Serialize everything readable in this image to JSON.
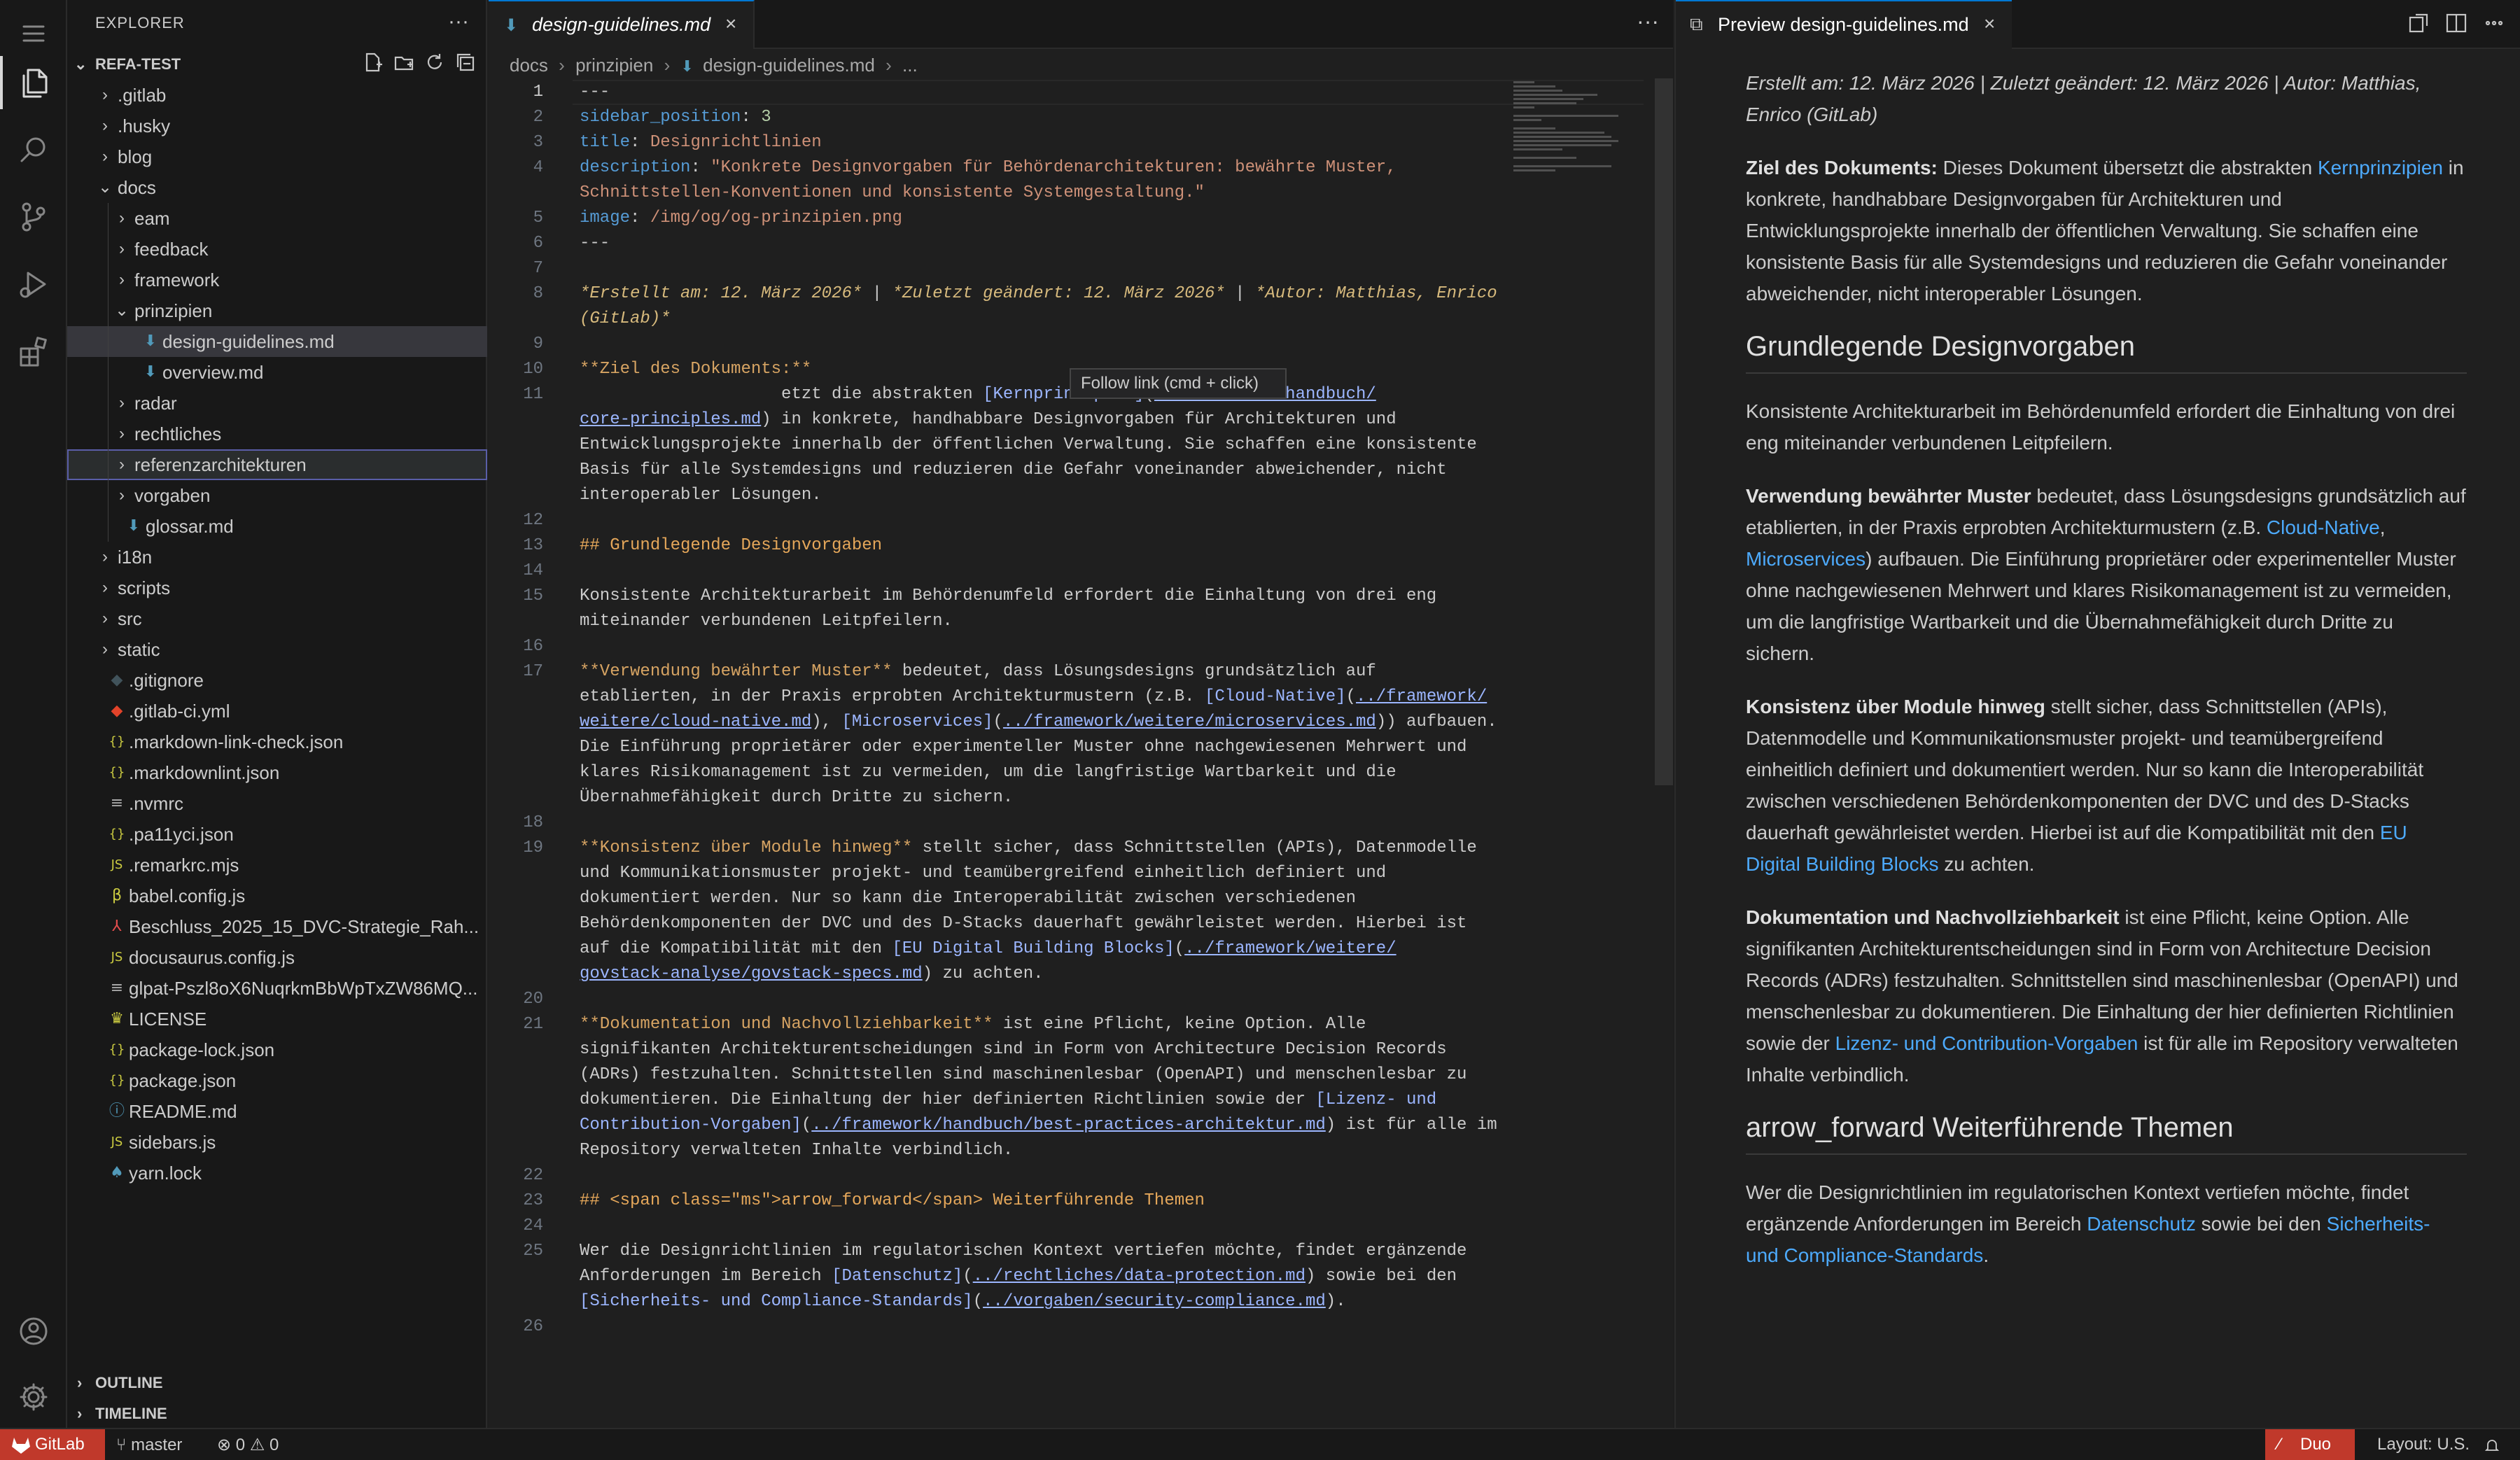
{
  "activity_bar": {
    "items": [
      {
        "name": "explorer",
        "active": true
      },
      {
        "name": "search",
        "active": false
      },
      {
        "name": "source-control",
        "active": false
      },
      {
        "name": "run-debug",
        "active": false
      },
      {
        "name": "extensions",
        "active": false
      }
    ]
  },
  "sidebar": {
    "title": "EXPLORER",
    "more": "···",
    "project": "REFA-TEST",
    "tree": [
      {
        "label": ".gitlab",
        "type": "folder",
        "depth": 0,
        "expanded": false
      },
      {
        "label": ".husky",
        "type": "folder",
        "depth": 0,
        "expanded": false
      },
      {
        "label": "blog",
        "type": "folder",
        "depth": 0,
        "expanded": false
      },
      {
        "label": "docs",
        "type": "folder",
        "depth": 0,
        "expanded": true
      },
      {
        "label": "eam",
        "type": "folder",
        "depth": 1,
        "expanded": false
      },
      {
        "label": "feedback",
        "type": "folder",
        "depth": 1,
        "expanded": false
      },
      {
        "label": "framework",
        "type": "folder",
        "depth": 1,
        "expanded": false
      },
      {
        "label": "prinzipien",
        "type": "folder",
        "depth": 1,
        "expanded": true
      },
      {
        "label": "design-guidelines.md",
        "type": "md",
        "depth": 2,
        "selected": true
      },
      {
        "label": "overview.md",
        "type": "md",
        "depth": 2
      },
      {
        "label": "radar",
        "type": "folder",
        "depth": 1,
        "expanded": false
      },
      {
        "label": "rechtliches",
        "type": "folder",
        "depth": 1,
        "expanded": false
      },
      {
        "label": "referenzarchitekturen",
        "type": "folder",
        "depth": 1,
        "expanded": false,
        "focused": true
      },
      {
        "label": "vorgaben",
        "type": "folder",
        "depth": 1,
        "expanded": false
      },
      {
        "label": "glossar.md",
        "type": "md",
        "depth": 1
      },
      {
        "label": "i18n",
        "type": "folder",
        "depth": 0,
        "expanded": false
      },
      {
        "label": "scripts",
        "type": "folder",
        "depth": 0,
        "expanded": false
      },
      {
        "label": "src",
        "type": "folder",
        "depth": 0,
        "expanded": false
      },
      {
        "label": "static",
        "type": "folder",
        "depth": 0,
        "expanded": false
      },
      {
        "label": ".gitignore",
        "type": "gitignore",
        "depth": 0
      },
      {
        "label": ".gitlab-ci.yml",
        "type": "gitlab",
        "depth": 0
      },
      {
        "label": ".markdown-link-check.json",
        "type": "json",
        "depth": 0
      },
      {
        "label": ".markdownlint.json",
        "type": "json",
        "depth": 0
      },
      {
        "label": ".nvmrc",
        "type": "text",
        "depth": 0
      },
      {
        "label": ".pa11yci.json",
        "type": "json",
        "depth": 0
      },
      {
        "label": ".remarkrc.mjs",
        "type": "js",
        "depth": 0
      },
      {
        "label": "babel.config.js",
        "type": "babel",
        "depth": 0
      },
      {
        "label": "Beschluss_2025_15_DVC-Strategie_Rah...",
        "type": "pdf",
        "depth": 0
      },
      {
        "label": "docusaurus.config.js",
        "type": "js",
        "depth": 0
      },
      {
        "label": "glpat-Pszl8oX6NuqrkmBbWpTxZW86MQ...",
        "type": "text",
        "depth": 0
      },
      {
        "label": "LICENSE",
        "type": "license",
        "depth": 0
      },
      {
        "label": "package-lock.json",
        "type": "json",
        "depth": 0
      },
      {
        "label": "package.json",
        "type": "json",
        "depth": 0
      },
      {
        "label": "README.md",
        "type": "info",
        "depth": 0
      },
      {
        "label": "sidebars.js",
        "type": "js",
        "depth": 0
      },
      {
        "label": "yarn.lock",
        "type": "yarn",
        "depth": 0
      }
    ],
    "outline": "OUTLINE",
    "timeline": "TIMELINE"
  },
  "editor": {
    "tab_label": "design-guidelines.md",
    "more": "···",
    "breadcrumbs": [
      "docs",
      "prinzipien",
      "design-guidelines.md",
      "..."
    ],
    "tooltip": "Follow link (cmd + click)",
    "lines": [
      {
        "n": "1",
        "segs": [
          [
            "p",
            "---"
          ]
        ]
      },
      {
        "n": "2",
        "segs": [
          [
            "k",
            "sidebar_position"
          ],
          [
            "p",
            ": "
          ],
          [
            "y",
            "3"
          ]
        ]
      },
      {
        "n": "3",
        "segs": [
          [
            "k",
            "title"
          ],
          [
            "p",
            ": "
          ],
          [
            "s",
            "Designrichtlinien"
          ]
        ]
      },
      {
        "n": "4",
        "segs": [
          [
            "k",
            "description"
          ],
          [
            "p",
            ": "
          ],
          [
            "s",
            "\"Konkrete Designvorgaben für Behördenarchitekturen: bewährte Muster,"
          ]
        ]
      },
      {
        "n": "",
        "segs": [
          [
            "s",
            "Schnittstellen-Konventionen und konsistente Systemgestaltung.\""
          ]
        ]
      },
      {
        "n": "5",
        "segs": [
          [
            "k",
            "image"
          ],
          [
            "p",
            ": "
          ],
          [
            "s",
            "/img/og/og-prinzipien.png"
          ]
        ]
      },
      {
        "n": "6",
        "segs": [
          [
            "p",
            "---"
          ]
        ]
      },
      {
        "n": "7",
        "segs": []
      },
      {
        "n": "8",
        "segs": [
          [
            "it",
            "*Erstellt am: 12. März 2026*"
          ],
          [
            "p",
            " | "
          ],
          [
            "it",
            "*Zuletzt geändert: 12. März 2026*"
          ],
          [
            "p",
            " | "
          ],
          [
            "it",
            "*Autor: Matthias, Enrico"
          ]
        ]
      },
      {
        "n": "",
        "segs": [
          [
            "it",
            "(GitLab)*"
          ]
        ]
      },
      {
        "n": "9",
        "segs": []
      },
      {
        "n": "10",
        "segs": [
          [
            "b",
            "**Ziel des Dokuments:**"
          ]
        ]
      },
      {
        "n": "11",
        "segs": [
          [
            "p",
            "                    etzt die abstrakten "
          ],
          [
            "lt",
            "[Kernprinzipien]"
          ],
          [
            "p",
            "("
          ],
          [
            "lk",
            "../framework/handbuch/"
          ]
        ]
      },
      {
        "n": "",
        "segs": [
          [
            "lk",
            "core-principles.md"
          ],
          [
            "p",
            ") in konkrete, handhabbare Designvorgaben für Architekturen und"
          ]
        ]
      },
      {
        "n": "",
        "segs": [
          [
            "p",
            "Entwicklungsprojekte innerhalb der öffentlichen Verwaltung. Sie schaffen eine konsistente"
          ]
        ]
      },
      {
        "n": "",
        "segs": [
          [
            "p",
            "Basis für alle Systemdesigns und reduzieren die Gefahr voneinander abweichender, nicht"
          ]
        ]
      },
      {
        "n": "",
        "segs": [
          [
            "p",
            "interoperabler Lösungen."
          ]
        ]
      },
      {
        "n": "12",
        "segs": []
      },
      {
        "n": "13",
        "segs": [
          [
            "hd",
            "## Grundlegende Designvorgaben"
          ]
        ]
      },
      {
        "n": "14",
        "segs": []
      },
      {
        "n": "15",
        "segs": [
          [
            "p",
            "Konsistente Architekturarbeit im Behördenumfeld erfordert die Einhaltung von drei eng"
          ]
        ]
      },
      {
        "n": "",
        "segs": [
          [
            "p",
            "miteinander verbundenen Leitpfeilern."
          ]
        ]
      },
      {
        "n": "16",
        "segs": []
      },
      {
        "n": "17",
        "segs": [
          [
            "b",
            "**Verwendung bewährter Muster**"
          ],
          [
            "p",
            " bedeutet, dass Lösungsdesigns grundsätzlich auf"
          ]
        ]
      },
      {
        "n": "",
        "segs": [
          [
            "p",
            "etablierten, in der Praxis erprobten Architekturmustern (z.B. "
          ],
          [
            "lt",
            "[Cloud-Native]"
          ],
          [
            "p",
            "("
          ],
          [
            "lk",
            "../framework/"
          ]
        ]
      },
      {
        "n": "",
        "segs": [
          [
            "lk",
            "weitere/cloud-native.md"
          ],
          [
            "p",
            "), "
          ],
          [
            "lt",
            "[Microservices]"
          ],
          [
            "p",
            "("
          ],
          [
            "lk",
            "../framework/weitere/microservices.md"
          ],
          [
            "p",
            ")) aufbauen."
          ]
        ]
      },
      {
        "n": "",
        "segs": [
          [
            "p",
            "Die Einführung proprietärer oder experimenteller Muster ohne nachgewiesenen Mehrwert und"
          ]
        ]
      },
      {
        "n": "",
        "segs": [
          [
            "p",
            "klares Risikomanagement ist zu vermeiden, um die langfristige Wartbarkeit und die"
          ]
        ]
      },
      {
        "n": "",
        "segs": [
          [
            "p",
            "Übernahmefähigkeit durch Dritte zu sichern."
          ]
        ]
      },
      {
        "n": "18",
        "segs": []
      },
      {
        "n": "19",
        "segs": [
          [
            "b",
            "**Konsistenz über Module hinweg**"
          ],
          [
            "p",
            " stellt sicher, dass Schnittstellen (APIs), Datenmodelle"
          ]
        ]
      },
      {
        "n": "",
        "segs": [
          [
            "p",
            "und Kommunikationsmuster projekt- und teamübergreifend einheitlich definiert und"
          ]
        ]
      },
      {
        "n": "",
        "segs": [
          [
            "p",
            "dokumentiert werden. Nur so kann die Interoperabilität zwischen verschiedenen"
          ]
        ]
      },
      {
        "n": "",
        "segs": [
          [
            "p",
            "Behördenkomponenten der DVC und des D-Stacks dauerhaft gewährleistet werden. Hierbei ist"
          ]
        ]
      },
      {
        "n": "",
        "segs": [
          [
            "p",
            "auf die Kompatibilität mit den "
          ],
          [
            "lt",
            "[EU Digital Building Blocks]"
          ],
          [
            "p",
            "("
          ],
          [
            "lk",
            "../framework/weitere/"
          ]
        ]
      },
      {
        "n": "",
        "segs": [
          [
            "lk",
            "govstack-analyse/govstack-specs.md"
          ],
          [
            "p",
            ") zu achten."
          ]
        ]
      },
      {
        "n": "20",
        "segs": []
      },
      {
        "n": "21",
        "segs": [
          [
            "b",
            "**Dokumentation und Nachvollziehbarkeit**"
          ],
          [
            "p",
            " ist eine Pflicht, keine Option. Alle"
          ]
        ]
      },
      {
        "n": "",
        "segs": [
          [
            "p",
            "signifikanten Architekturentscheidungen sind in Form von Architecture Decision Records"
          ]
        ]
      },
      {
        "n": "",
        "segs": [
          [
            "p",
            "(ADRs) festzuhalten. Schnittstellen sind maschinenlesbar (OpenAPI) und menschenlesbar zu"
          ]
        ]
      },
      {
        "n": "",
        "segs": [
          [
            "p",
            "dokumentieren. Die Einhaltung der hier definierten Richtlinien sowie der "
          ],
          [
            "lt",
            "[Lizenz- und"
          ]
        ]
      },
      {
        "n": "",
        "segs": [
          [
            "lt",
            "Contribution-Vorgaben]"
          ],
          [
            "p",
            "("
          ],
          [
            "lk",
            "../framework/handbuch/best-practices-architektur.md"
          ],
          [
            "p",
            ") ist für alle im"
          ]
        ]
      },
      {
        "n": "",
        "segs": [
          [
            "p",
            "Repository verwalteten Inhalte verbindlich."
          ]
        ]
      },
      {
        "n": "22",
        "segs": []
      },
      {
        "n": "23",
        "segs": [
          [
            "hd",
            "## <span class=\"ms\">arrow_forward</span> Weiterführende Themen"
          ]
        ]
      },
      {
        "n": "24",
        "segs": []
      },
      {
        "n": "25",
        "segs": [
          [
            "p",
            "Wer die Designrichtlinien im regulatorischen Kontext vertiefen möchte, findet ergänzende"
          ]
        ]
      },
      {
        "n": "",
        "segs": [
          [
            "p",
            "Anforderungen im Bereich "
          ],
          [
            "lt",
            "[Datenschutz]"
          ],
          [
            "p",
            "("
          ],
          [
            "lk",
            "../rechtliches/data-protection.md"
          ],
          [
            "p",
            ") sowie bei den"
          ]
        ]
      },
      {
        "n": "",
        "segs": [
          [
            "lt",
            "[Sicherheits- und Compliance-Standards]"
          ],
          [
            "p",
            "("
          ],
          [
            "lk",
            "../vorgaben/security-compliance.md"
          ],
          [
            "p",
            ")."
          ]
        ]
      },
      {
        "n": "26",
        "segs": []
      }
    ]
  },
  "preview": {
    "tab_label": "Preview design-guidelines.md",
    "meta": "Erstellt am: 12. März 2026 | Zuletzt geändert: 12. März 2026 | Autor: Matthias, Enrico (GitLab)",
    "p1_b": "Ziel des Dokuments:",
    "p1_t1": " Dieses Dokument übersetzt die abstrakten ",
    "p1_a": "Kernprinzipien",
    "p1_t2": " in konkrete, handhabbare Designvorgaben für Architekturen und Entwicklungsprojekte innerhalb der öffentlichen Verwaltung. Sie schaffen eine konsistente Basis für alle Systemdesigns und reduzieren die Gefahr voneinander abweichender, nicht interoperabler Lösungen.",
    "h2_1": "Grundlegende Designvorgaben",
    "p2": "Konsistente Architekturarbeit im Behördenumfeld erfordert die Einhaltung von drei eng miteinander verbundenen Leitpfeilern.",
    "p3_b": "Verwendung bewährter Muster",
    "p3_t1": " bedeutet, dass Lösungsdesigns grundsätzlich auf etablierten, in der Praxis erprobten Architekturmustern (z.B. ",
    "p3_a1": "Cloud-Native",
    "p3_t2": ", ",
    "p3_a2": "Microservices",
    "p3_t3": ") aufbauen. Die Einführung proprietärer oder experimenteller Muster ohne nachgewiesenen Mehrwert und klares Risikomanagement ist zu vermeiden, um die langfristige Wartbarkeit und die Übernahmefähigkeit durch Dritte zu sichern.",
    "p4_b": "Konsistenz über Module hinweg",
    "p4_t1": " stellt sicher, dass Schnittstellen (APIs), Datenmodelle und Kommunikationsmuster projekt- und teamübergreifend einheitlich definiert und dokumentiert werden. Nur so kann die Interoperabilität zwischen verschiedenen Behördenkomponenten der DVC und des D-Stacks dauerhaft gewährleistet werden. Hierbei ist auf die Kompatibilität mit den ",
    "p4_a": "EU Digital Building Blocks",
    "p4_t2": " zu achten.",
    "p5_b": "Dokumentation und Nachvollziehbarkeit",
    "p5_t1": " ist eine Pflicht, keine Option. Alle signifikanten Architekturentscheidungen sind in Form von Architecture Decision Records (ADRs) festzuhalten. Schnittstellen sind maschinenlesbar (OpenAPI) und menschenlesbar zu dokumentieren. Die Einhaltung der hier definierten Richtlinien sowie der ",
    "p5_a": "Lizenz- und Contribution-Vorgaben",
    "p5_t2": " ist für alle im Repository verwalteten Inhalte verbindlich.",
    "h2_2": "arrow_forward Weiterführende Themen",
    "p6_t1": "Wer die Designrichtlinien im regulatorischen Kontext vertiefen möchte, findet ergänzende Anforderungen im Bereich ",
    "p6_a1": "Datenschutz",
    "p6_t2": " sowie bei den ",
    "p6_a2": "Sicherheits- und Compliance-Standards",
    "p6_t3": "."
  },
  "statusbar": {
    "gitlab": "GitLab",
    "branch": "master",
    "errors": "0",
    "warnings": "0",
    "duo": "Duo",
    "layout": "Layout: U.S."
  },
  "colors": {
    "accent": "#0078d4",
    "gitlab_red": "#c0392b",
    "link": "#4daafc"
  }
}
